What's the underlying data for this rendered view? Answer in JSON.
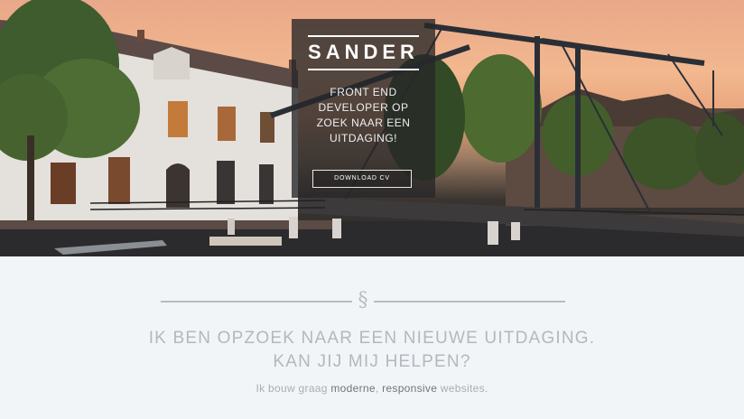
{
  "hero": {
    "name": "SANDER",
    "tagline_lines": [
      "FRONT END",
      "DEVELOPER OP",
      "ZOEK NAAR EEN",
      "UITDAGING!"
    ],
    "cv_button_label": "DOWNLOAD CV"
  },
  "intro": {
    "divider_icon": "§",
    "headline_line1": "IK BEN OPZOEK NAAR EEN NIEUWE UITDAGING.",
    "headline_line2": "KAN JIJ MIJ HELPEN?",
    "sub_prefix": "Ik bouw graag ",
    "sub_em1": "moderne",
    "sub_sep": ", ",
    "sub_em2": "responsive",
    "sub_suffix": " websites."
  },
  "colors": {
    "sky_warm": "#f2b88f",
    "box_bg": "#262628",
    "section_bg": "#f1f5f8",
    "muted_text": "#b3b8bd"
  }
}
